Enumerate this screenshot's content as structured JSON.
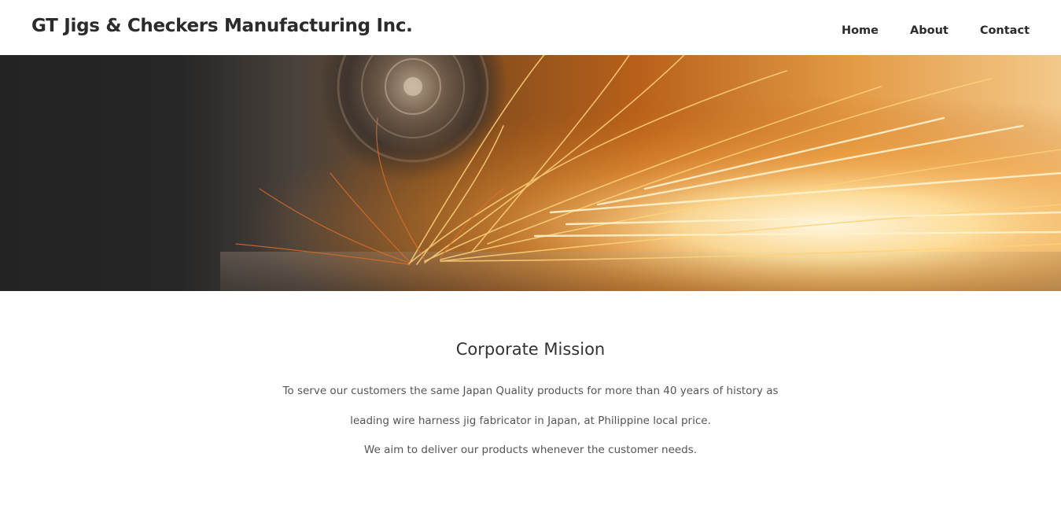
{
  "header": {
    "site_title": "GT Jigs & Checkers Manufacturing Inc.",
    "nav": [
      {
        "label": "Home"
      },
      {
        "label": "About"
      },
      {
        "label": "Contact"
      }
    ]
  },
  "hero": {
    "image": "grinder-sparks-banner"
  },
  "mission": {
    "title": "Corporate Mission",
    "lines": [
      "To serve our customers the same Japan Quality products for more than 40 years of history as",
      "leading wire harness jig fabricator in Japan, at Philippine local price.",
      "We aim to deliver our products whenever the customer needs."
    ]
  },
  "colors": {
    "text_dark": "#2b2b2b",
    "text_body": "#555555",
    "hero_dark": "#232323",
    "spark_orange": "#f08a24",
    "spark_yellow": "#ffe2a0"
  }
}
